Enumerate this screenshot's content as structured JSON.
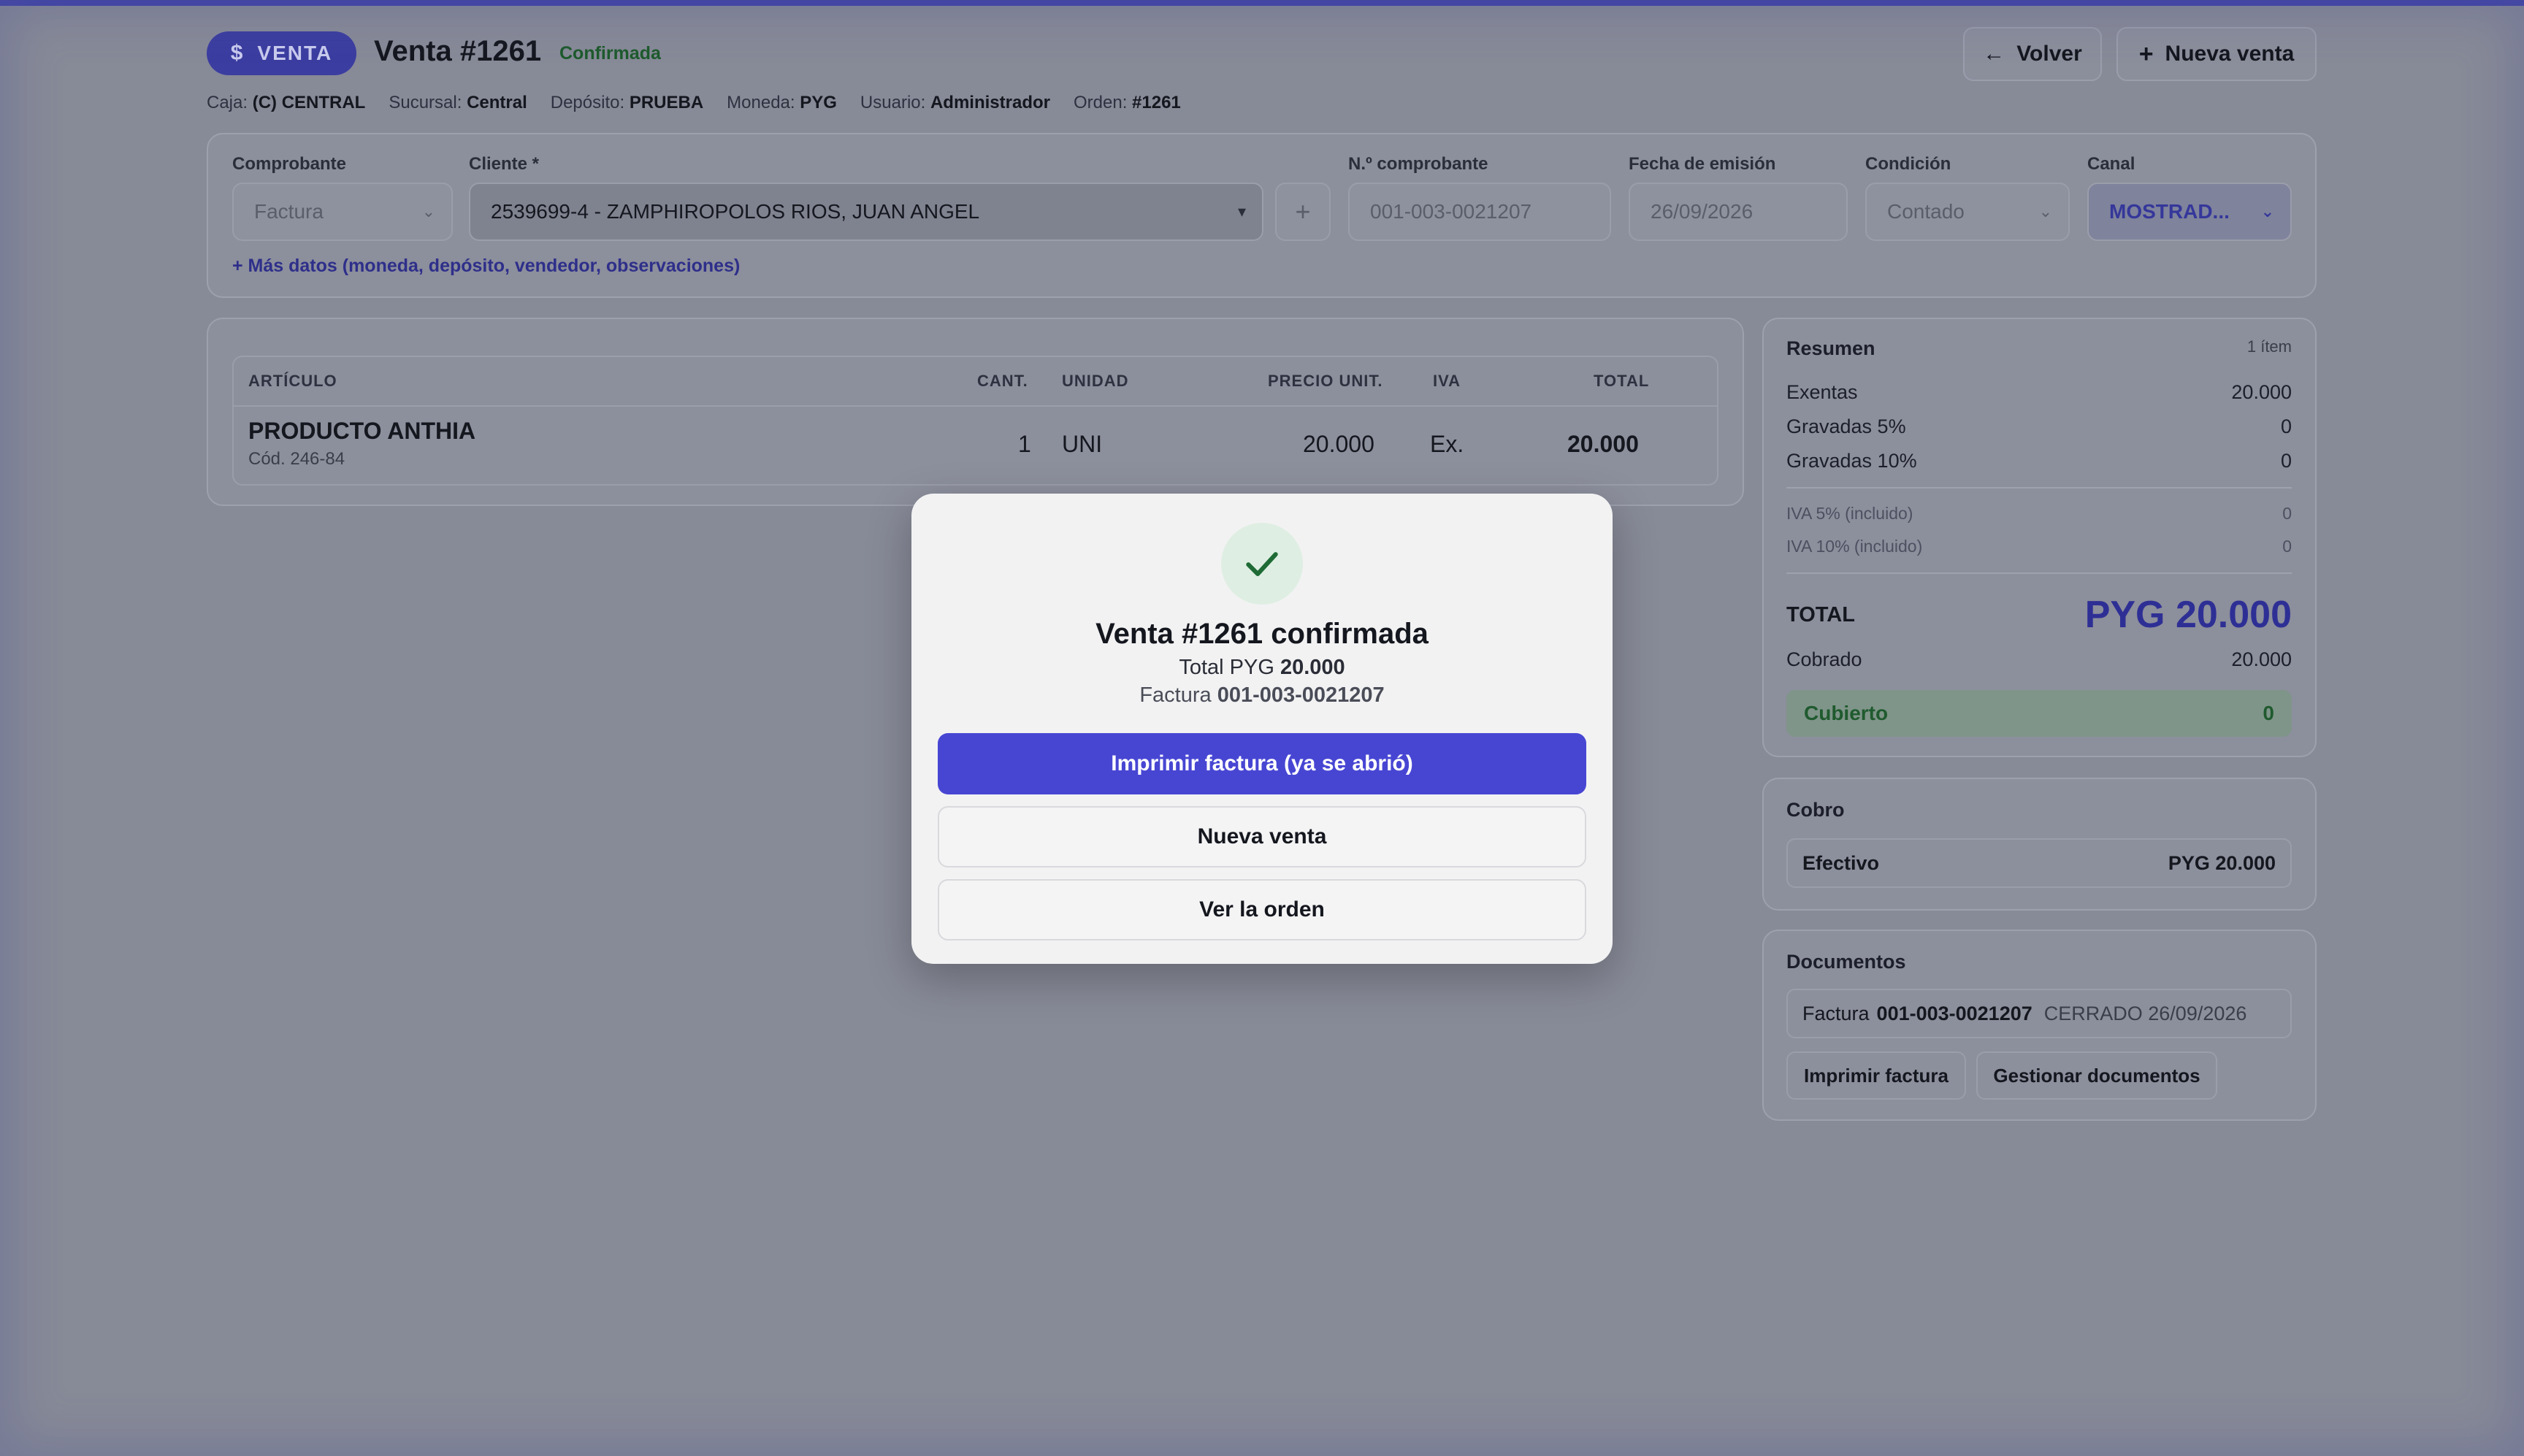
{
  "header": {
    "pill_icon": "$",
    "pill_label": "VENTA",
    "title": "Venta #1261",
    "status": "Confirmada",
    "back_label": "Volver",
    "new_sale_label": "Nueva venta"
  },
  "meta": [
    {
      "k": "Caja:",
      "v": "(C) CENTRAL"
    },
    {
      "k": "Sucursal:",
      "v": "Central"
    },
    {
      "k": "Depósito:",
      "v": "PRUEBA"
    },
    {
      "k": "Moneda:",
      "v": "PYG"
    },
    {
      "k": "Usuario:",
      "v": "Administrador"
    },
    {
      "k": "Orden:",
      "v": "#1261"
    }
  ],
  "form": {
    "comprobante_label": "Comprobante",
    "comprobante_value": "Factura",
    "cliente_label": "Cliente *",
    "cliente_value": "2539699-4 - ZAMPHIROPOLOS RIOS, JUAN ANGEL",
    "add_label": "+",
    "numero_label": "N.º comprobante",
    "numero_value": "001-003-0021207",
    "fecha_label": "Fecha de emisión",
    "fecha_value": "26/09/2026",
    "condicion_label": "Condición",
    "condicion_value": "Contado",
    "canal_label": "Canal",
    "canal_value": "MOSTRAD...",
    "more_link": "+ Más datos (moneda, depósito, vendedor, observaciones)"
  },
  "table": {
    "headers": [
      "ARTÍCULO",
      "CANT.",
      "UNIDAD",
      "PRECIO UNIT.",
      "IVA",
      "TOTAL"
    ],
    "rows": [
      {
        "name": "PRODUCTO ANTHIA",
        "code": "Cód. 246-84",
        "qty": "1",
        "unit": "UNI",
        "price": "20.000",
        "iva": "Ex.",
        "total": "20.000"
      }
    ]
  },
  "summary": {
    "title": "Resumen",
    "items_count": "1 ítem",
    "exentas_label": "Exentas",
    "exentas": "20.000",
    "g5_label": "Gravadas 5%",
    "g5": "0",
    "g10_label": "Gravadas 10%",
    "g10": "0",
    "iva5_label": "IVA 5% (incluido)",
    "iva5": "0",
    "iva10_label": "IVA 10% (incluido)",
    "iva10": "0",
    "total_label": "TOTAL",
    "total": "PYG 20.000",
    "cobrado_label": "Cobrado",
    "cobrado": "20.000",
    "cubierto_label": "Cubierto",
    "cubierto": "0"
  },
  "cobro": {
    "title": "Cobro",
    "method": "Efectivo",
    "amount": "PYG 20.000"
  },
  "documentos": {
    "title": "Documentos",
    "doc_prefix": "Factura",
    "doc_number": "001-003-0021207",
    "doc_status": "CERRADO 26/09/2026",
    "print_label": "Imprimir factura",
    "manage_label": "Gestionar documentos"
  },
  "modal": {
    "title": "Venta #1261 confirmada",
    "total_prefix": "Total PYG",
    "total_value": "20.000",
    "invoice_prefix": "Factura",
    "invoice_value": "001-003-0021207",
    "print_btn": "Imprimir factura (ya se abrió)",
    "new_btn": "Nueva venta",
    "view_btn": "Ver la orden"
  },
  "colors": {
    "accent": "#4746d3",
    "success": "#1d5a2c",
    "overlay": "#878a97"
  }
}
